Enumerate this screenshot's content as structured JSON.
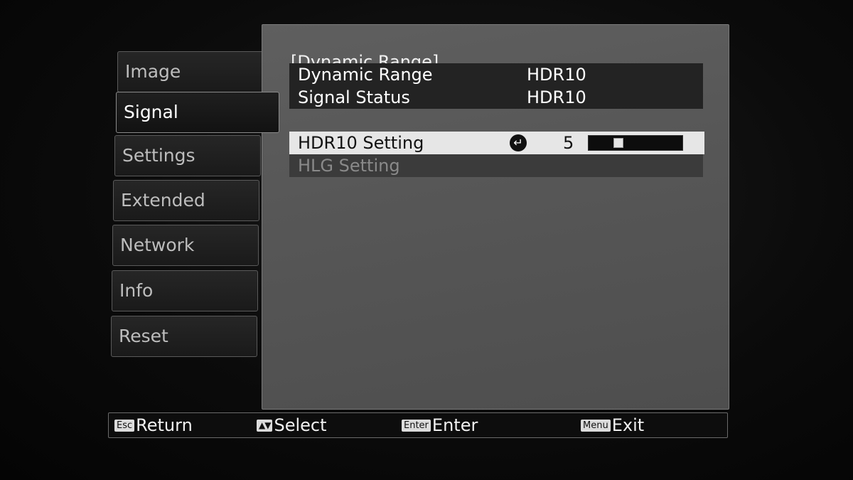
{
  "tabs": [
    {
      "label": "Image",
      "active": false
    },
    {
      "label": "Signal",
      "active": true
    },
    {
      "label": "Settings",
      "active": false
    },
    {
      "label": "Extended",
      "active": false
    },
    {
      "label": "Network",
      "active": false
    },
    {
      "label": "Info",
      "active": false
    },
    {
      "label": "Reset",
      "active": false
    }
  ],
  "panel": {
    "breadcrumb": "[Dynamic Range]",
    "rows": [
      {
        "label": "Dynamic Range",
        "value": "HDR10"
      },
      {
        "label": "Signal Status",
        "value": "HDR10"
      }
    ],
    "selected_row": {
      "label": "HDR10 Setting",
      "value": "5",
      "slider_level_fraction": 0.3,
      "icon": "enter-return-icon"
    },
    "disabled_row": {
      "label": "HLG Setting"
    }
  },
  "help_bar": [
    {
      "key": "Esc",
      "label": "Return"
    },
    {
      "key": "▲▼",
      "label": "Select"
    },
    {
      "key": "Enter",
      "label": "Enter"
    },
    {
      "key": "Menu",
      "label": "Exit"
    }
  ],
  "colors": {
    "panel": "#575757",
    "selected_row": "#e6e6e6",
    "row_dark": "#232323",
    "disabled_text": "#8a8a8a"
  }
}
